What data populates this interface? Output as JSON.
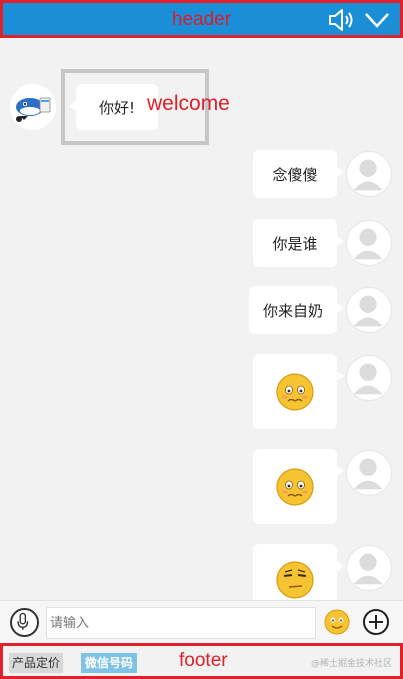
{
  "header": {
    "title": "header",
    "sound_icon": "speaker-icon",
    "collapse_icon": "chevron-down-icon",
    "bg_color": "#1a8fd8",
    "frame_color": "#e0202a"
  },
  "welcome": {
    "label": "welcome",
    "message": "你好!"
  },
  "messages": [
    {
      "text": "念傻傻",
      "type": "text"
    },
    {
      "text": "你是谁",
      "type": "text"
    },
    {
      "text": "你来自奶",
      "type": "text"
    },
    {
      "emoji": "worried-face"
    },
    {
      "emoji": "worried-face"
    },
    {
      "emoji": "smirk-face"
    }
  ],
  "input": {
    "placeholder": "请输入",
    "mic_icon": "microphone-icon",
    "emoji_icon": "smiley-icon",
    "plus_icon": "plus-icon"
  },
  "footer": {
    "title": "footer",
    "tag_pricing": "产品定价",
    "tag_wechat": "微信号码",
    "watermark": "@稀土掘金技术社区"
  }
}
